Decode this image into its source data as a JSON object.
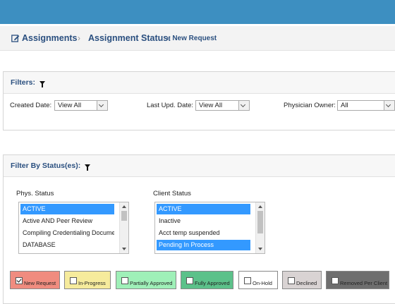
{
  "breadcrumb": {
    "assignments": "Assignments",
    "separator": "›",
    "status_label": "Assignment Status:",
    "current": "» New Request"
  },
  "filters": {
    "title": "Filters:",
    "created_date_label": "Created Date:",
    "created_date_value": "View All",
    "last_upd_label": "Last Upd. Date:",
    "last_upd_value": "View All",
    "physician_owner_label": "Physician Owner:",
    "physician_owner_value": "All"
  },
  "status_filter": {
    "title": "Filter By Status(es):",
    "phys_label": "Phys. Status",
    "phys_items": [
      {
        "label": "ACTIVE",
        "selected": true
      },
      {
        "label": "Active AND Peer Review",
        "selected": false
      },
      {
        "label": "Compiling Credentialing Documen",
        "selected": false
      },
      {
        "label": "DATABASE",
        "selected": false
      }
    ],
    "client_label": "Client Status",
    "client_items": [
      {
        "label": "ACTIVE",
        "selected": true
      },
      {
        "label": "Inactive",
        "selected": false
      },
      {
        "label": "Acct temp suspended",
        "selected": false
      },
      {
        "label": "Pending In Process",
        "selected": true
      }
    ]
  },
  "statuses": [
    {
      "label": "New Request",
      "checked": true,
      "color": "#f08c7f"
    },
    {
      "label": "In-Progress",
      "checked": false,
      "color": "#f6eb9c"
    },
    {
      "label": "Partially Approved",
      "checked": false,
      "color": "#9ff0b8"
    },
    {
      "label": "Fully Approved",
      "checked": false,
      "color": "#5cc18a"
    },
    {
      "label": "On-Hold",
      "checked": false,
      "color": "#ffffff"
    },
    {
      "label": "Declined",
      "checked": false,
      "color": "#d9d3d3"
    },
    {
      "label": "Removed Per Client",
      "checked": false,
      "color": "#6e6e6e"
    }
  ],
  "colors": {
    "topbar": "#3d8fc1",
    "heading_text": "#2a4f7f",
    "selection": "#3399ff"
  }
}
